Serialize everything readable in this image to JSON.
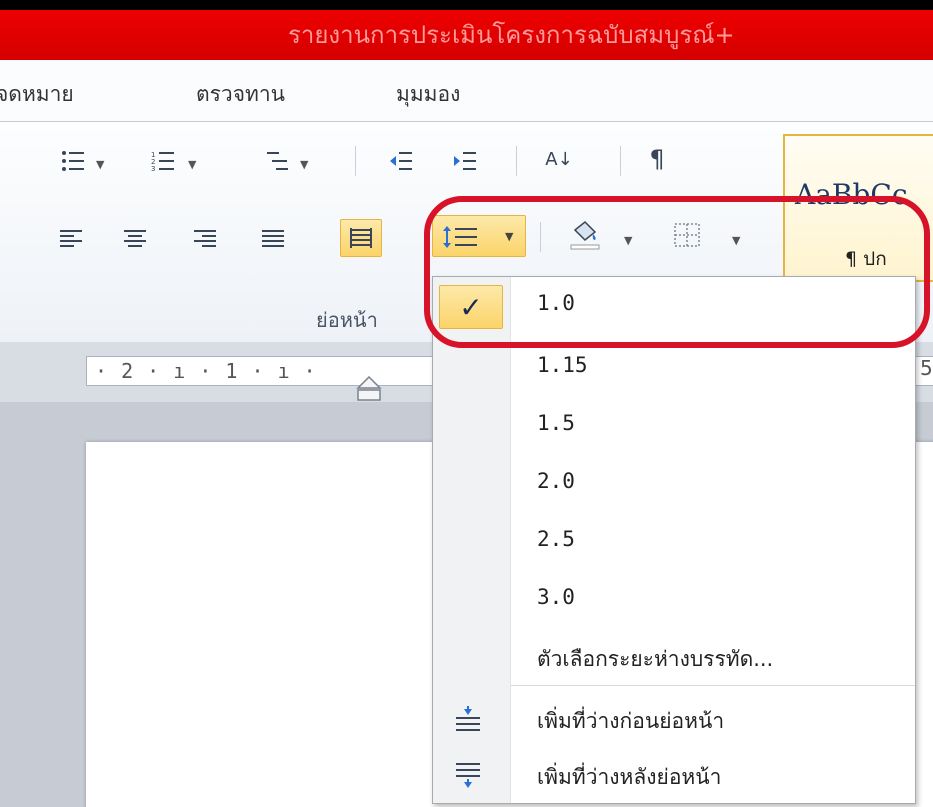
{
  "title": "รายงานการประเมินโครงการฉบับสมบูรณ์+",
  "tabs": [
    "จดหมาย",
    "ตรวจทาน",
    "มุมมอง"
  ],
  "ribbon": {
    "group_label": "ย่อหน้า",
    "pilcrow": "¶",
    "sort_icon": "A↓",
    "styles_sample": "AaBbCc",
    "styles_name": "¶ ปก"
  },
  "ruler": {
    "marks": "· 2 · ı · 1 · ı ·",
    "right_mark": "5"
  },
  "line_spacing_menu": {
    "check": "✓",
    "options": [
      "1.0",
      "1.15",
      "1.5",
      "2.0",
      "2.5",
      "3.0"
    ],
    "selected": "1.0",
    "more_options": "ตัวเลือกระยะห่างบรรทัด...",
    "add_space_before": "เพิ่มที่ว่างก่อนย่อหน้า",
    "add_space_after": "เพิ่มที่ว่างหลังย่อหน้า"
  },
  "colors": {
    "title_bar": "#e00000",
    "highlight": "#d7132a",
    "selected_fill": "#fbd46a"
  }
}
